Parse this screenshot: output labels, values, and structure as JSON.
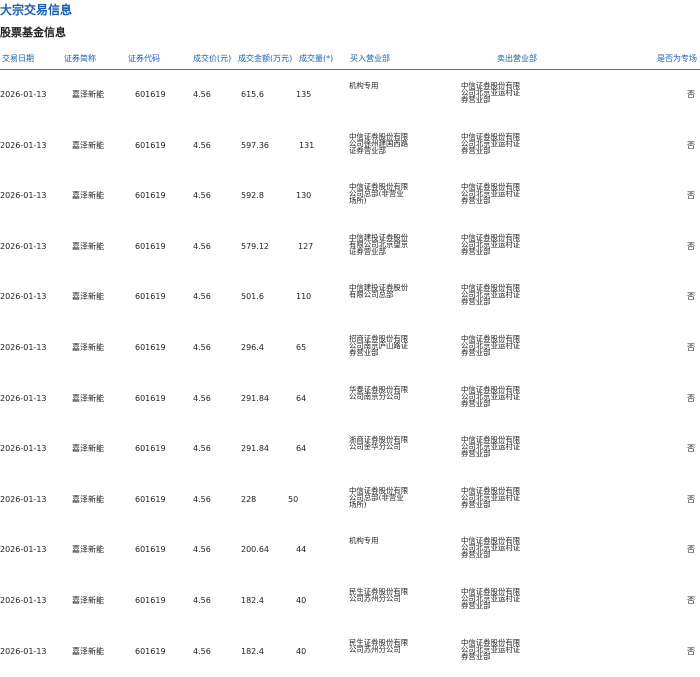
{
  "title": "大宗交易信息",
  "subtitle": "股票基金信息",
  "columns": [
    "交易日期",
    "证券简称",
    "证券代码",
    "成交价(元)",
    "成交金额(万元)",
    "成交量(*)",
    "买入营业部",
    "卖出营业部",
    "是否为专场"
  ],
  "rows": [
    {
      "date": "2026-01-13",
      "name": "嘉泽新能",
      "code": "601619",
      "price": "4.56",
      "amount": "615.6",
      "volume": "135",
      "buyer": "机构专用",
      "seller": "中信证券股份有限公司北京亚运村证券营业部",
      "special": "否"
    },
    {
      "date": "2026-01-13",
      "name": "嘉泽新能",
      "code": "601619",
      "price": "4.56",
      "amount": "597.36",
      "volume": "131",
      "buyer": "中信证券股份有限公司徐州建国西路证券营业部",
      "seller": "中信证券股份有限公司北京亚运村证券营业部",
      "special": "否"
    },
    {
      "date": "2026-01-13",
      "name": "嘉泽新能",
      "code": "601619",
      "price": "4.56",
      "amount": "592.8",
      "volume": "130",
      "buyer": "中信证券股份有限公司总部(非营业场所)",
      "seller": "中信证券股份有限公司北京亚运村证券营业部",
      "special": "否"
    },
    {
      "date": "2026-01-13",
      "name": "嘉泽新能",
      "code": "601619",
      "price": "4.56",
      "amount": "579.12",
      "volume": "127",
      "buyer": "中信建投证券股份有限公司北京望京证券营业部",
      "seller": "中信证券股份有限公司北京亚运村证券营业部",
      "special": "否"
    },
    {
      "date": "2026-01-13",
      "name": "嘉泽新能",
      "code": "601619",
      "price": "4.56",
      "amount": "501.6",
      "volume": "110",
      "buyer": "中信建投证券股份有限公司总部",
      "seller": "中信证券股份有限公司北京亚运村证券营业部",
      "special": "否"
    },
    {
      "date": "2026-01-13",
      "name": "嘉泽新能",
      "code": "601619",
      "price": "4.56",
      "amount": "296.4",
      "volume": "65",
      "buyer": "招商证券股份有限公司南京庐山路证券营业部",
      "seller": "中信证券股份有限公司北京亚运村证券营业部",
      "special": "否"
    },
    {
      "date": "2026-01-13",
      "name": "嘉泽新能",
      "code": "601619",
      "price": "4.56",
      "amount": "291.84",
      "volume": "64",
      "buyer": "华泰证券股份有限公司南京分公司",
      "seller": "中信证券股份有限公司北京亚运村证券营业部",
      "special": "否"
    },
    {
      "date": "2026-01-13",
      "name": "嘉泽新能",
      "code": "601619",
      "price": "4.56",
      "amount": "291.84",
      "volume": "64",
      "buyer": "浙商证券股份有限公司金华分公司",
      "seller": "中信证券股份有限公司北京亚运村证券营业部",
      "special": "否"
    },
    {
      "date": "2026-01-13",
      "name": "嘉泽新能",
      "code": "601619",
      "price": "4.56",
      "amount": "228",
      "volume": "50",
      "buyer": "中信证券股份有限公司总部(非营业场所)",
      "seller": "中信证券股份有限公司北京亚运村证券营业部",
      "special": "否"
    },
    {
      "date": "2026-01-13",
      "name": "嘉泽新能",
      "code": "601619",
      "price": "4.56",
      "amount": "200.64",
      "volume": "44",
      "buyer": "机构专用",
      "seller": "中信证券股份有限公司北京亚运村证券营业部",
      "special": "否"
    },
    {
      "date": "2026-01-13",
      "name": "嘉泽新能",
      "code": "601619",
      "price": "4.56",
      "amount": "182.4",
      "volume": "40",
      "buyer": "民生证券股份有限公司苏州分公司",
      "seller": "中信证券股份有限公司北京亚运村证券营业部",
      "special": "否"
    },
    {
      "date": "2026-01-13",
      "name": "嘉泽新能",
      "code": "601619",
      "price": "4.56",
      "amount": "182.4",
      "volume": "40",
      "buyer": "民生证券股份有限公司苏州分公司",
      "seller": "中信证券股份有限公司北京亚运村证券营业部",
      "special": "否"
    }
  ]
}
